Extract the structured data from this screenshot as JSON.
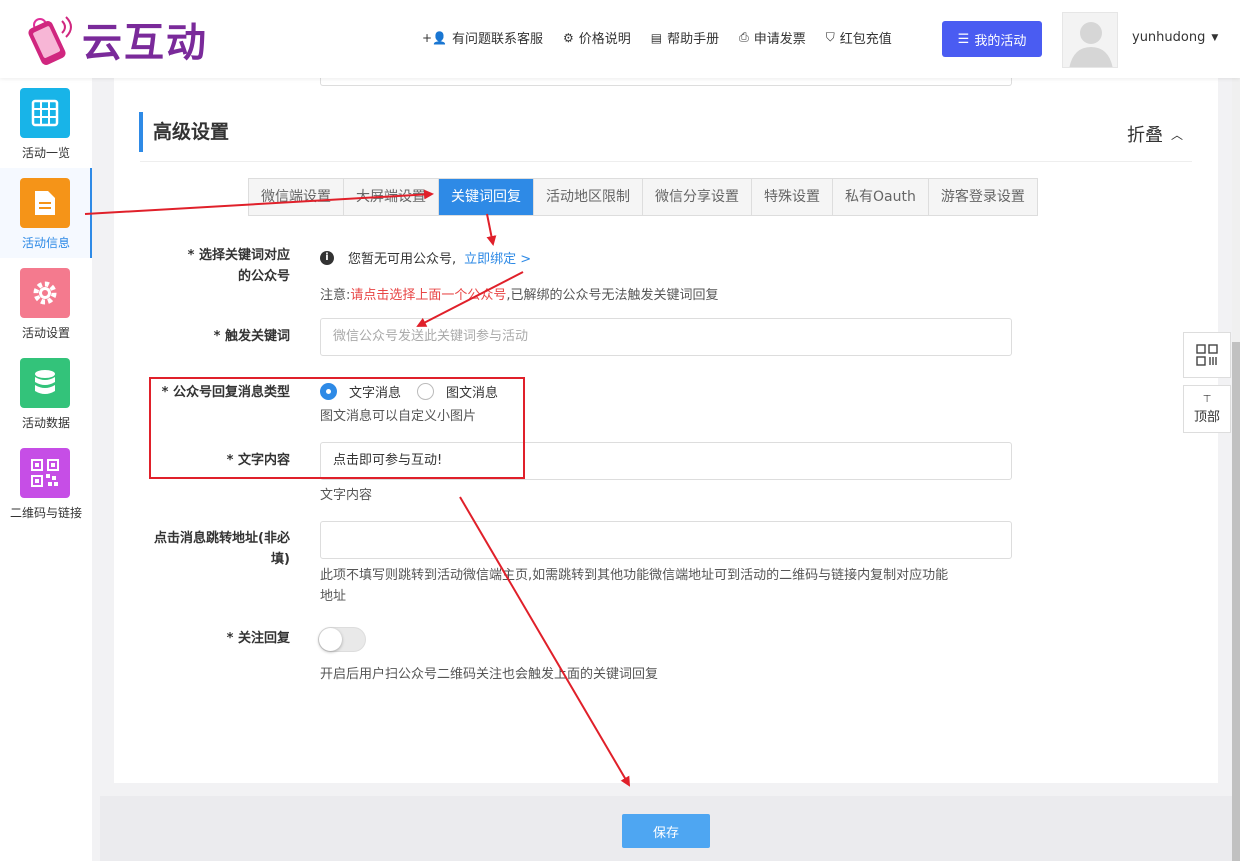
{
  "header": {
    "logo_text": "云互动",
    "nav": [
      {
        "icon": "user-plus-icon",
        "label": "有问题联系客服"
      },
      {
        "icon": "gear-icon",
        "label": "价格说明"
      },
      {
        "icon": "book-icon",
        "label": "帮助手册"
      },
      {
        "icon": "printer-icon",
        "label": "申请发票"
      },
      {
        "icon": "shield-icon",
        "label": "红包充值"
      }
    ],
    "my_activity": "我的活动",
    "username": "yunhudong"
  },
  "sidebar": {
    "items": [
      {
        "label": "活动一览",
        "icon": "grid-icon",
        "color": "#18b4e8"
      },
      {
        "label": "活动信息",
        "icon": "document-icon",
        "color": "#f59418",
        "active": true
      },
      {
        "label": "活动设置",
        "icon": "gear-icon",
        "color": "#f47a8e"
      },
      {
        "label": "活动数据",
        "icon": "database-icon",
        "color": "#33c37a"
      },
      {
        "label": "二维码与链接",
        "icon": "qrcode-icon",
        "color": "#c64ee6"
      }
    ]
  },
  "section": {
    "title": "高级设置",
    "collapse": "折叠"
  },
  "tabs": [
    "微信端设置",
    "大屏端设置",
    "关键词回复",
    "活动地区限制",
    "微信分享设置",
    "特殊设置",
    "私有Oauth",
    "游客登录设置"
  ],
  "active_tab": "关键词回复",
  "form": {
    "account_label_1": "* 选择关键词对应",
    "account_label_2": "的公众号",
    "no_account_text": "您暂无可用公众号,",
    "bind_link": "立即绑定 >",
    "note_prefix": "注意:",
    "note_red": "请点击选择上面一个公众号",
    "note_suffix": ",已解绑的公众号无法触发关键词回复",
    "keyword_label": "* 触发关键词",
    "keyword_placeholder": "微信公众号发送此关键词参与活动",
    "reply_type_label": "* 公众号回复消息类型",
    "reply_type_options": [
      "文字消息",
      "图文消息"
    ],
    "reply_type_selected": "文字消息",
    "reply_type_help": "图文消息可以自定义小图片",
    "text_content_label": "* 文字内容",
    "text_content_value": "点击即可参与互动!",
    "text_content_help": "文字内容",
    "jump_label_1": "点击消息跳转地址(非必",
    "jump_label_2": "填)",
    "jump_value": "",
    "jump_help_1": "此项不填写则跳转到活动微信端主页,如需跳转到其他功能微信端地址可到活动的二维码与链接内复制对应功能",
    "jump_help_2": "地址",
    "follow_label": "* 关注回复",
    "follow_enabled": false,
    "follow_help": "开启后用户扫公众号二维码关注也会触发上面的关键词回复"
  },
  "save_label": "保存",
  "float": {
    "top_label": "顶部"
  }
}
